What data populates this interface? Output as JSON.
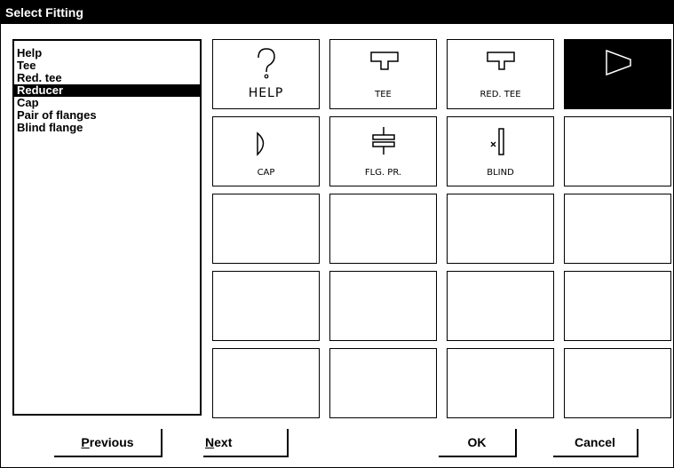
{
  "window": {
    "title": "Select Fitting"
  },
  "list": {
    "items": [
      {
        "label": "Help"
      },
      {
        "label": "Tee"
      },
      {
        "label": "Red. tee"
      },
      {
        "label": "Reducer",
        "selected": true
      },
      {
        "label": "Cap"
      },
      {
        "label": "Pair of flanges"
      },
      {
        "label": "Blind flange"
      }
    ]
  },
  "grid": {
    "tiles": [
      {
        "label": "HELP",
        "icon": "help-question-icon"
      },
      {
        "label": "TEE",
        "icon": "tee-icon"
      },
      {
        "label": "RED. TEE",
        "icon": "reducing-tee-icon"
      },
      {
        "label": "",
        "icon": "reducer-icon",
        "selected": true
      },
      {
        "label": "CAP",
        "icon": "cap-icon"
      },
      {
        "label": "FLG. PR.",
        "icon": "flange-pair-icon"
      },
      {
        "label": "BLIND",
        "icon": "blind-flange-icon"
      },
      {
        "label": ""
      },
      {
        "label": ""
      },
      {
        "label": ""
      },
      {
        "label": ""
      },
      {
        "label": ""
      },
      {
        "label": ""
      },
      {
        "label": ""
      },
      {
        "label": ""
      },
      {
        "label": ""
      },
      {
        "label": ""
      },
      {
        "label": ""
      },
      {
        "label": ""
      },
      {
        "label": ""
      }
    ]
  },
  "buttons": {
    "previous": {
      "mnemonic": "P",
      "rest": "revious"
    },
    "next": {
      "mnemonic": "N",
      "rest": "ext"
    },
    "ok": {
      "label": "OK"
    },
    "cancel": {
      "label": "Cancel"
    }
  },
  "colors": {
    "selected_bg": "#000000",
    "selected_fg": "#ffffff",
    "background": "#ffffff"
  }
}
